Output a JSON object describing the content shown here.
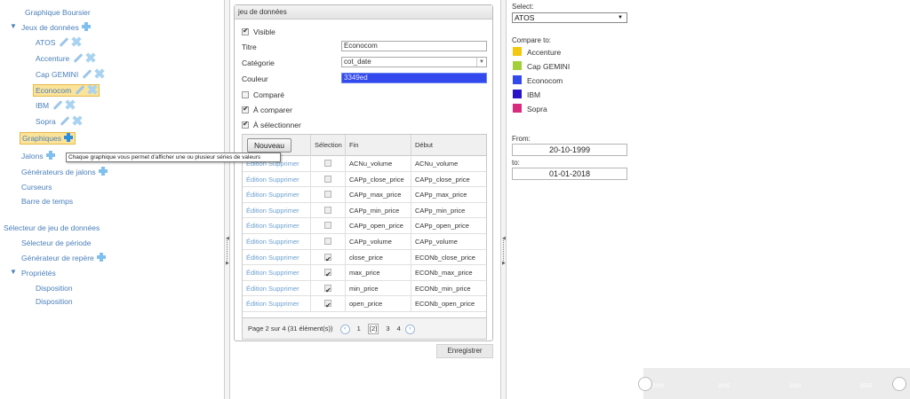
{
  "tree": {
    "graphique_boursier": "Graphique Boursier",
    "jeux_de_donnees": "Jeux de données",
    "datasets": [
      "ATOS",
      "Accenture",
      "Cap GEMINI",
      "Econocom",
      "IBM",
      "Sopra"
    ],
    "graphiques": "Graphiques",
    "jalons": "Jalons",
    "generateurs_jalons": "Générateurs de jalons",
    "curseurs": "Curseurs",
    "barre_de_temps": "Barre de temps",
    "selecteur_jeu": "Sélecteur de jeu de données",
    "selecteur_periode": "Sélecteur de période",
    "generateur_repere": "Générateur de repère",
    "proprietes": "Propriétés",
    "disposition_1": "Disposition",
    "disposition_2": "Disposition"
  },
  "tooltip": "Chaque graphique vous permet d'afficher une ou plusieur séries de valeurs",
  "form": {
    "title": "jeu de données",
    "visible_label": "Visible",
    "visible_checked": true,
    "titre_label": "Titre",
    "titre_value": "Econocom",
    "categorie_label": "Catégorie",
    "categorie_value": "cot_date",
    "couleur_label": "Couleur",
    "couleur_value": "3349ed",
    "couleur_hex": "#3349ed",
    "compare_label": "Comparé",
    "compare_checked": false,
    "a_comparer_label": "À comparer",
    "a_comparer_checked": true,
    "a_selectionner_label": "À sélectionner",
    "a_selectionner_checked": true,
    "nouveau_label": "Nouveau",
    "columns": [
      "Sélection",
      "Fin",
      "Début"
    ],
    "rows": [
      {
        "actions": "Édition Supprimer",
        "selected": false,
        "fin": "ACNu_volume",
        "debut": "ACNu_volume"
      },
      {
        "actions": "Édition Supprimer",
        "selected": false,
        "fin": "CAPp_close_price",
        "debut": "CAPp_close_price"
      },
      {
        "actions": "Édition Supprimer",
        "selected": false,
        "fin": "CAPp_max_price",
        "debut": "CAPp_max_price"
      },
      {
        "actions": "Édition Supprimer",
        "selected": false,
        "fin": "CAPp_min_price",
        "debut": "CAPp_min_price"
      },
      {
        "actions": "Édition Supprimer",
        "selected": false,
        "fin": "CAPp_open_price",
        "debut": "CAPp_open_price"
      },
      {
        "actions": "Édition Supprimer",
        "selected": false,
        "fin": "CAPp_volume",
        "debut": "CAPp_volume"
      },
      {
        "actions": "Édition Supprimer",
        "selected": true,
        "fin": "close_price",
        "debut": "ECONb_close_price"
      },
      {
        "actions": "Édition Supprimer",
        "selected": true,
        "fin": "max_price",
        "debut": "ECONb_max_price"
      },
      {
        "actions": "Édition Supprimer",
        "selected": true,
        "fin": "min_price",
        "debut": "ECONb_min_price"
      },
      {
        "actions": "Édition Supprimer",
        "selected": true,
        "fin": "open_price",
        "debut": "ECONb_open_price"
      }
    ],
    "pager": {
      "text": "Page 2 sur 4 (31 élément(s))",
      "pages": [
        "1",
        "[2]",
        "3",
        "4"
      ],
      "prev": "‹",
      "next": "›"
    },
    "save_label": "Enregistrer"
  },
  "right": {
    "select_label": "Select:",
    "select_value": "ATOS",
    "compare_label": "Compare to:",
    "compare_items": [
      {
        "name": "Accenture",
        "color": "#f2c811"
      },
      {
        "name": "Cap GEMINI",
        "color": "#a2cf3a"
      },
      {
        "name": "Econocom",
        "color": "#3349ed"
      },
      {
        "name": "IBM",
        "color": "#2a12c9"
      },
      {
        "name": "Sopra",
        "color": "#d92a7f"
      }
    ],
    "from_label": "From:",
    "from_value": "20-10-1999",
    "to_label": "to:",
    "to_value": "01-01-2018"
  },
  "timeline": {
    "ticks": [
      "2000",
      "2005",
      "2010",
      "2015"
    ]
  }
}
